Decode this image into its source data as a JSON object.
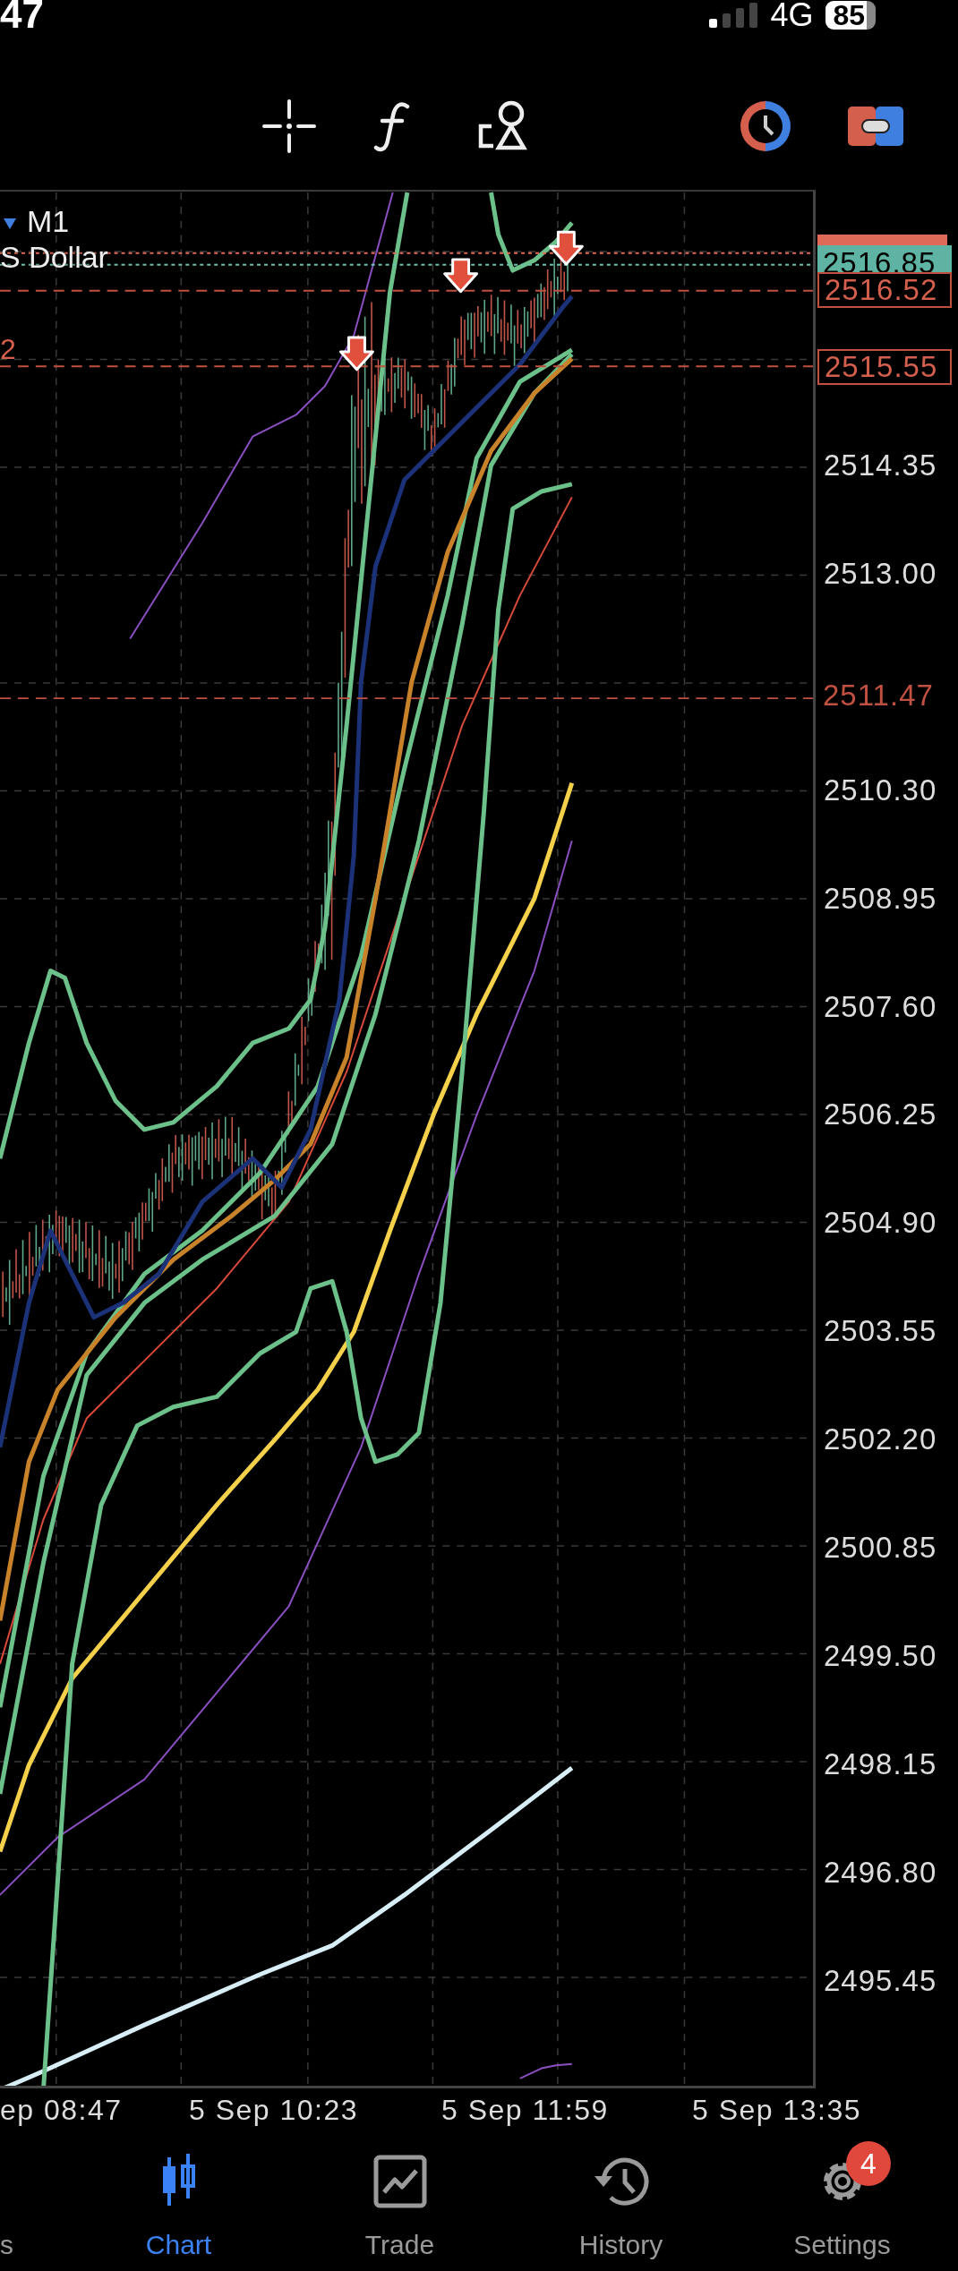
{
  "status_bar": {
    "time": "47",
    "network": "4G",
    "battery": "85"
  },
  "chart": {
    "timeframe": "M1",
    "symbol": "S Dollar",
    "level_marker": "2",
    "price_tags": [
      {
        "text": "2516.85",
        "kind": "bid"
      },
      {
        "text": "2516.52",
        "kind": "order"
      },
      {
        "text": "2515.55",
        "kind": "order"
      },
      {
        "text": "2511.47",
        "kind": "level"
      }
    ],
    "price_axis": [
      "2514.35",
      "2513.00",
      "2510.30",
      "2508.95",
      "2507.60",
      "2506.25",
      "2504.90",
      "2503.55",
      "2502.20",
      "2500.85",
      "2499.50",
      "2498.15",
      "2496.80",
      "2495.45"
    ],
    "time_axis": [
      "ep 08:47",
      "5 Sep 10:23",
      "5 Sep 11:59",
      "5 Sep 13:35"
    ]
  },
  "tabs": [
    {
      "label": "s",
      "kind": "cut",
      "selected": false
    },
    {
      "label": "Chart",
      "kind": "chart",
      "selected": true
    },
    {
      "label": "Trade",
      "kind": "trade",
      "selected": false
    },
    {
      "label": "History",
      "kind": "history",
      "selected": false
    },
    {
      "label": "Settings",
      "kind": "settings",
      "selected": false,
      "badge": "4"
    }
  ]
}
